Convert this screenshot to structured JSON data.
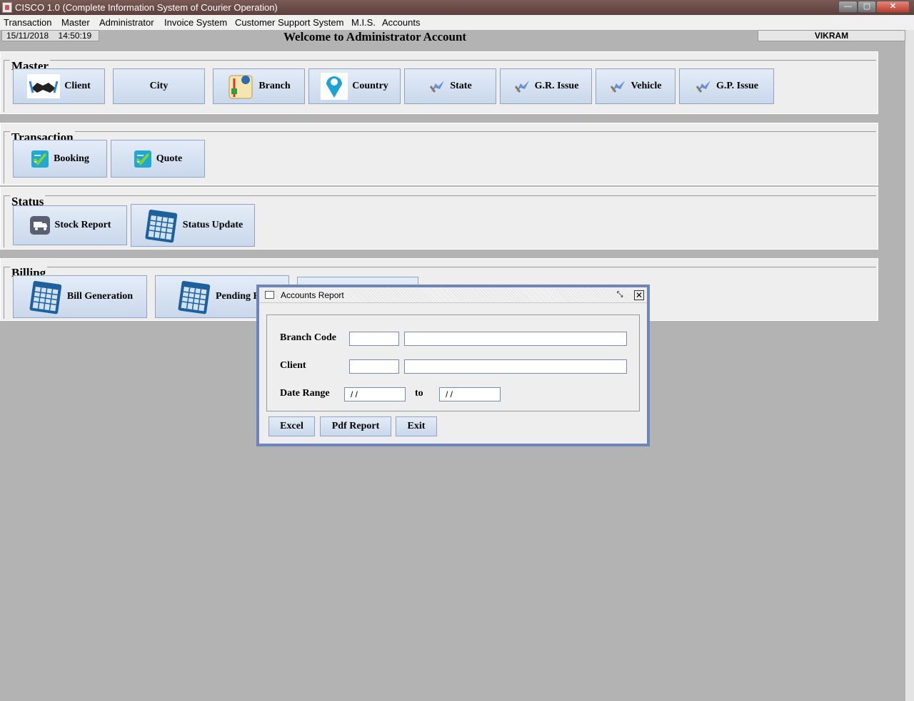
{
  "window": {
    "title": "CISCO 1.0 (Complete Information System of Courier Operation)"
  },
  "menu": [
    "Transaction",
    "Master",
    "Administrator",
    "Invoice System",
    "Customer Support System",
    "M.I.S.",
    "Accounts"
  ],
  "status": {
    "date": "15/11/2018",
    "time": "14:50:19",
    "welcome": "Welcome to Administrator Account",
    "user": "VIKRAM"
  },
  "sections": {
    "master": {
      "title": "Master",
      "buttons": [
        "Client",
        "City",
        "Branch",
        "Country",
        "State",
        "G.R. Issue",
        "Vehicle",
        "G.P. Issue"
      ]
    },
    "transaction": {
      "title": "Transaction",
      "buttons": [
        "Booking",
        "Quote"
      ]
    },
    "status": {
      "title": "Status",
      "buttons": [
        "Stock Report",
        "Status Update"
      ]
    },
    "billing": {
      "title": "Billing",
      "buttons": [
        "Bill Generation",
        "Pending B"
      ]
    }
  },
  "dialog": {
    "title": "Accounts Report",
    "branch_label": "Branch Code",
    "client_label": "Client",
    "date_label": "Date Range",
    "to_label": "to",
    "date_from": "/ /",
    "date_to": "/ /",
    "excel": "Excel",
    "pdf": "Pdf Report",
    "exit": "Exit"
  },
  "icons": {
    "client": "handshake-icon",
    "branch": "map-signpost-icon",
    "country": "map-pin-icon",
    "generic": "hand-pointer-icon",
    "check": "checklist-icon",
    "truck": "truck-icon",
    "calendar": "calendar-icon"
  }
}
